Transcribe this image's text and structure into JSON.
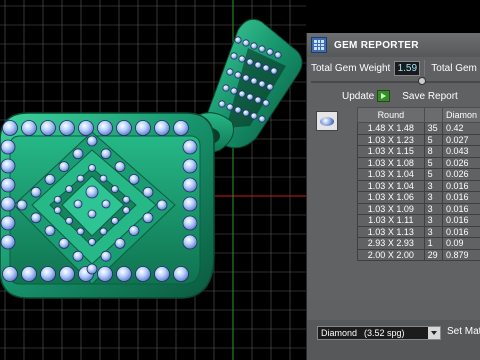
{
  "panel": {
    "title": "GEM REPORTER",
    "total_gem_weight_label": "Total Gem Weight",
    "total_gem_weight_value": "1.59",
    "total_gem_count_label": "Total Gem Co",
    "update_label": "Update",
    "save_report_label": "Save Report"
  },
  "table": {
    "headers": [
      "Round",
      "",
      "Diamon"
    ],
    "rows": [
      [
        "1.48 X 1.48",
        "35",
        "0.42"
      ],
      [
        "1.03 X 1.23",
        "5",
        "0.027"
      ],
      [
        "1.03 X 1.15",
        "8",
        "0.043"
      ],
      [
        "1.03 X 1.08",
        "5",
        "0.026"
      ],
      [
        "1.03 X 1.04",
        "5",
        "0.026"
      ],
      [
        "1.03 X 1.04",
        "3",
        "0.016"
      ],
      [
        "1.03 X 1.06",
        "3",
        "0.016"
      ],
      [
        "1.03 X 1.09",
        "3",
        "0.016"
      ],
      [
        "1.03 X 1.11",
        "3",
        "0.016"
      ],
      [
        "1.03 X 1.13",
        "3",
        "0.016"
      ],
      [
        "2.93 X 2.93",
        "1",
        "0.09"
      ],
      [
        "2.00 X 2.00",
        "29",
        "0.879"
      ]
    ]
  },
  "footer": {
    "material_name": "Diamond",
    "material_sg": "(3.52 spg)",
    "set_material_label": "Set Mate"
  },
  "colors": {
    "metal": "#1fa57a",
    "gem": "#b8d4ff",
    "grid": "#5a5a5a",
    "axis_red": "#c81b1b"
  },
  "icons": {
    "title": "gem-reporter-icon",
    "update": "play-icon",
    "gem_thumbnail": "round-gem-icon",
    "dropdown": "chevron-down-icon"
  }
}
